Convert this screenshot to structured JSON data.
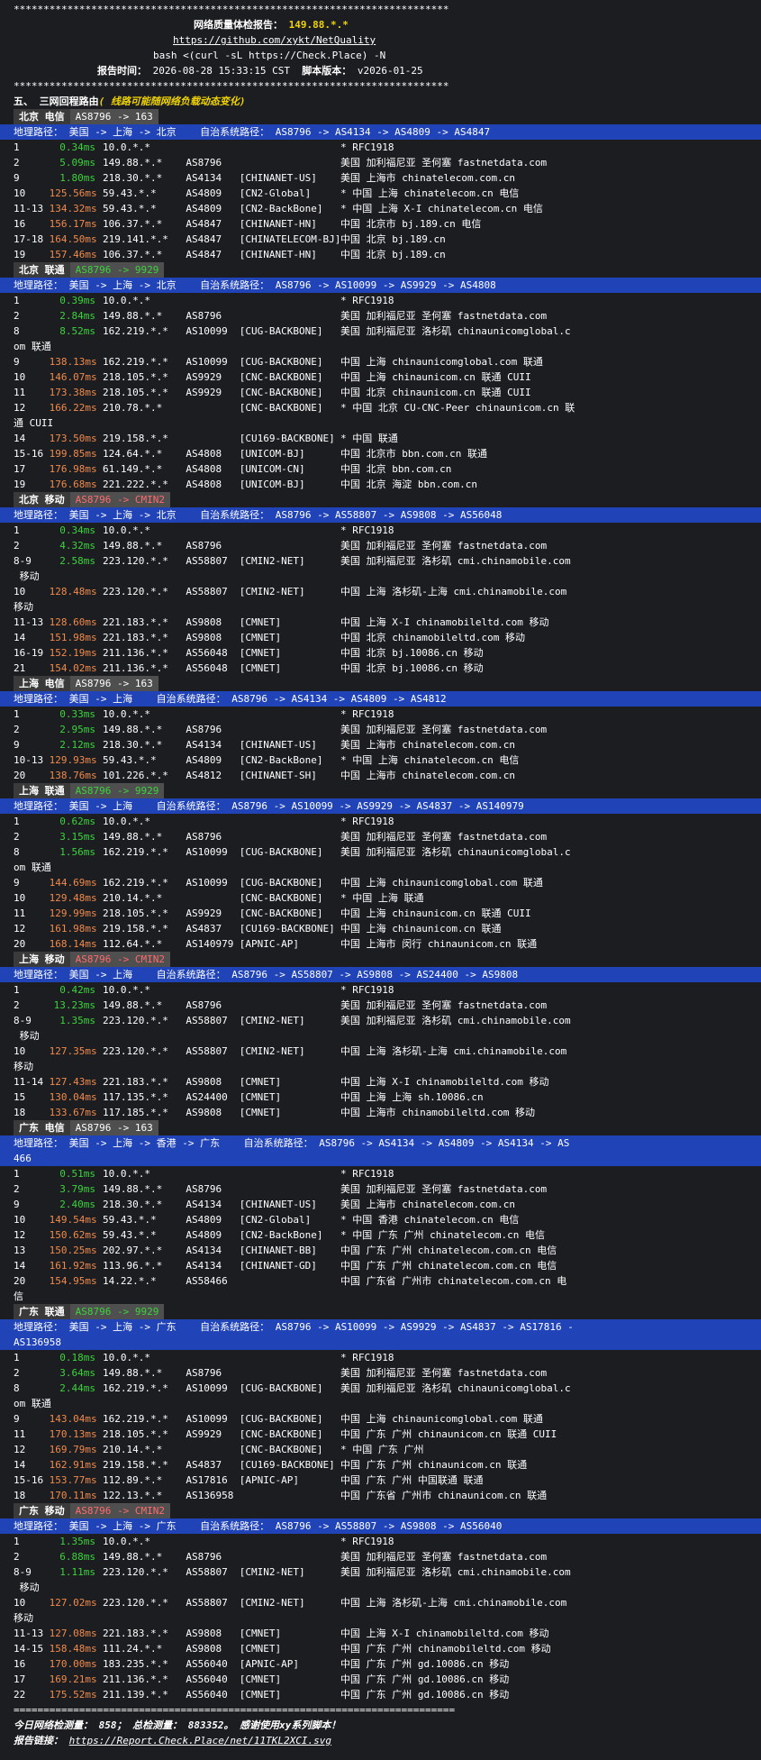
{
  "header": {
    "stars": "*************************************************************************",
    "title_label": "网络质量体检报告：",
    "title_ip": "149.88.*.*",
    "repo": "https://github.com/xykt/NetQuality",
    "cmd": "bash <(curl -sL https://Check.Place) -N",
    "time_label": "报告时间：",
    "time_value": "2026-08-28 15:33:15 CST",
    "ver_label": "脚本版本：",
    "ver_value": "v2026-01-25"
  },
  "section": {
    "num": "五、",
    "title": "三网回程路由",
    "note": "( 线路可能随网络负载动态变化)"
  },
  "blocks": [
    {
      "city": "北京",
      "isp": "电信",
      "as_tag": "AS8796 -> 163",
      "path": "地理路径： 美国 -> 上海 -> 北京    自治系统路径： AS8796 -> AS4134 -> AS4809 -> AS4847",
      "rows": [
        [
          "1",
          "0.34ms",
          "10.0.*.*",
          "",
          "",
          "* RFC1918"
        ],
        [
          "2",
          "5.09ms",
          "149.88.*.*",
          "AS8796",
          "",
          "美国 加利福尼亚 圣何塞 fastnetdata.com"
        ],
        [
          "9",
          "1.80ms",
          "218.30.*.*",
          "AS4134",
          "[CHINANET-US]",
          "美国 上海市 chinatelecom.com.cn"
        ],
        [
          "10",
          "125.56ms",
          "59.43.*.*",
          "AS4809",
          "[CN2-Global]",
          "* 中国 上海 chinatelecom.cn 电信"
        ],
        [
          "11-13",
          "134.32ms",
          "59.43.*.*",
          "AS4809",
          "[CN2-BackBone]",
          "* 中国 上海 X-I chinatelecom.cn 电信"
        ],
        [
          "16",
          "156.17ms",
          "106.37.*.*",
          "AS4847",
          "[CHINANET-HN]",
          "中国 北京市 bj.189.cn 电信"
        ],
        [
          "17-18",
          "164.50ms",
          "219.141.*.*",
          "AS4847",
          "[CHINATELECOM-BJ]",
          "中国 北京 bj.189.cn"
        ],
        [
          "19",
          "157.46ms",
          "106.37.*.*",
          "AS4847",
          "[CHINANET-HN]",
          "中国 北京 bj.189.cn"
        ]
      ]
    },
    {
      "city": "北京",
      "isp": "联通",
      "as_tag": "AS8796 -> 9929",
      "path": "地理路径： 美国 -> 上海 -> 北京    自治系统路径： AS8796 -> AS10099 -> AS9929 -> AS4808",
      "rows": [
        [
          "1",
          "0.39ms",
          "10.0.*.*",
          "",
          "",
          "* RFC1918"
        ],
        [
          "2",
          "2.84ms",
          "149.88.*.*",
          "AS8796",
          "",
          "美国 加利福尼亚 圣何塞 fastnetdata.com"
        ],
        [
          "8",
          "8.52ms",
          "162.219.*.*",
          "AS10099",
          "[CUG-BACKBONE]",
          "美国 加利福尼亚 洛杉矶 chinaunicomglobal.c",
          "om 联通"
        ],
        [
          "9",
          "138.13ms",
          "162.219.*.*",
          "AS10099",
          "[CUG-BACKBONE]",
          "中国 上海 chinaunicomglobal.com 联通"
        ],
        [
          "10",
          "146.07ms",
          "218.105.*.*",
          "AS9929",
          "[CNC-BACKBONE]",
          "中国 上海 chinaunicom.cn 联通 CUII"
        ],
        [
          "11",
          "173.38ms",
          "218.105.*.*",
          "AS9929",
          "[CNC-BACKBONE]",
          "中国 北京 chinaunicom.cn 联通 CUII"
        ],
        [
          "12",
          "166.22ms",
          "210.78.*.*",
          "",
          "[CNC-BACKBONE]",
          "* 中国 北京 CU-CNC-Peer chinaunicom.cn 联",
          "通 CUII"
        ],
        [
          "14",
          "173.50ms",
          "219.158.*.*",
          "",
          "[CU169-BACKBONE]",
          "* 中国 联通"
        ],
        [
          "15-16",
          "199.85ms",
          "124.64.*.*",
          "AS4808",
          "[UNICOM-BJ]",
          "中国 北京市 bbn.com.cn 联通"
        ],
        [
          "17",
          "176.98ms",
          "61.149.*.*",
          "AS4808",
          "[UNICOM-CN]",
          "中国 北京 bbn.com.cn"
        ],
        [
          "19",
          "176.68ms",
          "221.222.*.*",
          "AS4808",
          "[UNICOM-BJ]",
          "中国 北京 海淀 bbn.com.cn"
        ]
      ]
    },
    {
      "city": "北京",
      "isp": "移动",
      "as_tag": "AS8796 -> CMIN2",
      "path": "地理路径： 美国 -> 上海 -> 北京    自治系统路径： AS8796 -> AS58807 -> AS9808 -> AS56048",
      "rows": [
        [
          "1",
          "0.34ms",
          "10.0.*.*",
          "",
          "",
          "* RFC1918"
        ],
        [
          "2",
          "4.32ms",
          "149.88.*.*",
          "AS8796",
          "",
          "美国 加利福尼亚 圣何塞 fastnetdata.com"
        ],
        [
          "8-9",
          "2.58ms",
          "223.120.*.*",
          "AS58807",
          "[CMIN2-NET]",
          "美国 加利福尼亚 洛杉矶 cmi.chinamobile.com",
          " 移动"
        ],
        [
          "10",
          "128.48ms",
          "223.120.*.*",
          "AS58807",
          "[CMIN2-NET]",
          "中国 上海 洛杉矶-上海 cmi.chinamobile.com",
          "移动"
        ],
        [
          "11-13",
          "128.60ms",
          "221.183.*.*",
          "AS9808",
          "[CMNET]",
          "中国 上海 X-I chinamobileltd.com 移动"
        ],
        [
          "14",
          "151.98ms",
          "221.183.*.*",
          "AS9808",
          "[CMNET]",
          "中国 北京 chinamobileltd.com 移动"
        ],
        [
          "16-19",
          "152.19ms",
          "211.136.*.*",
          "AS56048",
          "[CMNET]",
          "中国 北京 bj.10086.cn 移动"
        ],
        [
          "21",
          "154.02ms",
          "211.136.*.*",
          "AS56048",
          "[CMNET]",
          "中国 北京 bj.10086.cn 移动"
        ]
      ]
    },
    {
      "city": "上海",
      "isp": "电信",
      "as_tag": "AS8796 -> 163",
      "path": "地理路径： 美国 -> 上海    自治系统路径： AS8796 -> AS4134 -> AS4809 -> AS4812",
      "rows": [
        [
          "1",
          "0.33ms",
          "10.0.*.*",
          "",
          "",
          "* RFC1918"
        ],
        [
          "2",
          "2.95ms",
          "149.88.*.*",
          "AS8796",
          "",
          "美国 加利福尼亚 圣何塞 fastnetdata.com"
        ],
        [
          "9",
          "2.12ms",
          "218.30.*.*",
          "AS4134",
          "[CHINANET-US]",
          "美国 上海市 chinatelecom.com.cn"
        ],
        [
          "10-13",
          "129.93ms",
          "59.43.*.*",
          "AS4809",
          "[CN2-BackBone]",
          "* 中国 上海 chinatelecom.cn 电信"
        ],
        [
          "20",
          "138.76ms",
          "101.226.*.*",
          "AS4812",
          "[CHINANET-SH]",
          "中国 上海市 chinatelecom.com.cn"
        ]
      ]
    },
    {
      "city": "上海",
      "isp": "联通",
      "as_tag": "AS8796 -> 9929",
      "path": "地理路径： 美国 -> 上海    自治系统路径： AS8796 -> AS10099 -> AS9929 -> AS4837 -> AS140979",
      "rows": [
        [
          "1",
          "0.62ms",
          "10.0.*.*",
          "",
          "",
          "* RFC1918"
        ],
        [
          "2",
          "3.15ms",
          "149.88.*.*",
          "AS8796",
          "",
          "美国 加利福尼亚 圣何塞 fastnetdata.com"
        ],
        [
          "8",
          "1.56ms",
          "162.219.*.*",
          "AS10099",
          "[CUG-BACKBONE]",
          "美国 加利福尼亚 洛杉矶 chinaunicomglobal.c",
          "om 联通"
        ],
        [
          "9",
          "144.69ms",
          "162.219.*.*",
          "AS10099",
          "[CUG-BACKBONE]",
          "中国 上海 chinaunicomglobal.com 联通"
        ],
        [
          "10",
          "129.48ms",
          "210.14.*.*",
          "",
          "[CNC-BACKBONE]",
          "* 中国 上海 联通"
        ],
        [
          "11",
          "129.99ms",
          "218.105.*.*",
          "AS9929",
          "[CNC-BACKBONE]",
          "中国 上海 chinaunicom.cn 联通 CUII"
        ],
        [
          "12",
          "161.98ms",
          "219.158.*.*",
          "AS4837",
          "[CU169-BACKBONE]",
          "中国 上海 chinaunicom.cn 联通"
        ],
        [
          "20",
          "168.14ms",
          "112.64.*.*",
          "AS140979",
          "[APNIC-AP]",
          "中国 上海市 闵行 chinaunicom.cn 联通"
        ]
      ]
    },
    {
      "city": "上海",
      "isp": "移动",
      "as_tag": "AS8796 -> CMIN2",
      "path": "地理路径： 美国 -> 上海    自治系统路径： AS8796 -> AS58807 -> AS9808 -> AS24400 -> AS9808",
      "rows": [
        [
          "1",
          "0.42ms",
          "10.0.*.*",
          "",
          "",
          "* RFC1918"
        ],
        [
          "2",
          "13.23ms",
          "149.88.*.*",
          "AS8796",
          "",
          "美国 加利福尼亚 圣何塞 fastnetdata.com"
        ],
        [
          "8-9",
          "1.35ms",
          "223.120.*.*",
          "AS58807",
          "[CMIN2-NET]",
          "美国 加利福尼亚 洛杉矶 cmi.chinamobile.com",
          " 移动"
        ],
        [
          "10",
          "127.35ms",
          "223.120.*.*",
          "AS58807",
          "[CMIN2-NET]",
          "中国 上海 洛杉矶-上海 cmi.chinamobile.com",
          "移动"
        ],
        [
          "11-14",
          "127.43ms",
          "221.183.*.*",
          "AS9808",
          "[CMNET]",
          "中国 上海 X-I chinamobileltd.com 移动"
        ],
        [
          "15",
          "130.04ms",
          "117.135.*.*",
          "AS24400",
          "[CMNET]",
          "中国 上海 上海 sh.10086.cn"
        ],
        [
          "18",
          "133.67ms",
          "117.185.*.*",
          "AS9808",
          "[CMNET]",
          "中国 上海市 chinamobileltd.com 移动"
        ]
      ]
    },
    {
      "city": "广东",
      "isp": "电信",
      "as_tag": "AS8796 -> 163",
      "path": "地理路径： 美国 -> 上海 -> 香港 -> 广东    自治系统路径： AS8796 -> AS4134 -> AS4809 -> AS4134 -> AS",
      "path2": "466",
      "rows": [
        [
          "1",
          "0.51ms",
          "10.0.*.*",
          "",
          "",
          "* RFC1918"
        ],
        [
          "2",
          "3.79ms",
          "149.88.*.*",
          "AS8796",
          "",
          "美国 加利福尼亚 圣何塞 fastnetdata.com"
        ],
        [
          "9",
          "2.40ms",
          "218.30.*.*",
          "AS4134",
          "[CHINANET-US]",
          "美国 上海市 chinatelecom.com.cn"
        ],
        [
          "10",
          "149.54ms",
          "59.43.*.*",
          "AS4809",
          "[CN2-Global]",
          "* 中国 香港 chinatelecom.cn 电信"
        ],
        [
          "12",
          "150.62ms",
          "59.43.*.*",
          "AS4809",
          "[CN2-BackBone]",
          "* 中国 广东 广州 chinatelecom.cn 电信"
        ],
        [
          "13",
          "150.25ms",
          "202.97.*.*",
          "AS4134",
          "[CHINANET-BB]",
          "中国 广东 广州 chinatelecom.com.cn 电信"
        ],
        [
          "14",
          "161.92ms",
          "113.96.*.*",
          "AS4134",
          "[CHINANET-GD]",
          "中国 广东 广州 chinatelecom.com.cn 电信"
        ],
        [
          "20",
          "154.95ms",
          "14.22.*.*",
          "AS58466",
          "",
          "中国 广东省 广州市 chinatelecom.com.cn 电",
          "信"
        ]
      ]
    },
    {
      "city": "广东",
      "isp": "联通",
      "as_tag": "AS8796 -> 9929",
      "path": "地理路径： 美国 -> 上海 -> 广东    自治系统路径： AS8796 -> AS10099 -> AS9929 -> AS4837 -> AS17816 -",
      "path2": "AS136958",
      "rows": [
        [
          "1",
          "0.18ms",
          "10.0.*.*",
          "",
          "",
          "* RFC1918"
        ],
        [
          "2",
          "3.64ms",
          "149.88.*.*",
          "AS8796",
          "",
          "美国 加利福尼亚 圣何塞 fastnetdata.com"
        ],
        [
          "8",
          "2.44ms",
          "162.219.*.*",
          "AS10099",
          "[CUG-BACKBONE]",
          "美国 加利福尼亚 洛杉矶 chinaunicomglobal.c",
          "om 联通"
        ],
        [
          "9",
          "143.04ms",
          "162.219.*.*",
          "AS10099",
          "[CUG-BACKBONE]",
          "中国 上海 chinaunicomglobal.com 联通"
        ],
        [
          "11",
          "170.13ms",
          "218.105.*.*",
          "AS9929",
          "[CNC-BACKBONE]",
          "中国 广东 广州 chinaunicom.cn 联通 CUII"
        ],
        [
          "12",
          "169.79ms",
          "210.14.*.*",
          "",
          "[CNC-BACKBONE]",
          "* 中国 广东 广州"
        ],
        [
          "14",
          "162.91ms",
          "219.158.*.*",
          "AS4837",
          "[CU169-BACKBONE]",
          "中国 广东 广州 chinaunicom.cn 联通"
        ],
        [
          "15-16",
          "153.77ms",
          "112.89.*.*",
          "AS17816",
          "[APNIC-AP]",
          "中国 广东 广州 中国联通 联通"
        ],
        [
          "18",
          "170.11ms",
          "122.13.*.*",
          "AS136958",
          "",
          "中国 广东省 广州市 chinaunicom.cn 联通"
        ]
      ]
    },
    {
      "city": "广东",
      "isp": "移动",
      "as_tag": "AS8796 -> CMIN2",
      "path": "地理路径： 美国 -> 上海 -> 广东    自治系统路径： AS8796 -> AS58807 -> AS9808 -> AS56040",
      "rows": [
        [
          "1",
          "1.35ms",
          "10.0.*.*",
          "",
          "",
          "* RFC1918"
        ],
        [
          "2",
          "6.88ms",
          "149.88.*.*",
          "AS8796",
          "",
          "美国 加利福尼亚 圣何塞 fastnetdata.com"
        ],
        [
          "8-9",
          "1.11ms",
          "223.120.*.*",
          "AS58807",
          "[CMIN2-NET]",
          "美国 加利福尼亚 洛杉矶 cmi.chinamobile.com",
          " 移动"
        ],
        [
          "10",
          "127.02ms",
          "223.120.*.*",
          "AS58807",
          "[CMIN2-NET]",
          "中国 上海 洛杉矶-上海 cmi.chinamobile.com",
          "移动"
        ],
        [
          "11-13",
          "127.08ms",
          "221.183.*.*",
          "AS9808",
          "[CMNET]",
          "中国 上海 X-I chinamobileltd.com 移动"
        ],
        [
          "14-15",
          "158.48ms",
          "111.24.*.*",
          "AS9808",
          "[CMNET]",
          "中国 广东 广州 chinamobileltd.com 移动"
        ],
        [
          "16",
          "170.00ms",
          "183.235.*.*",
          "AS56040",
          "[APNIC-AP]",
          "中国 广东 广州 gd.10086.cn 移动"
        ],
        [
          "17",
          "169.21ms",
          "211.136.*.*",
          "AS56040",
          "[CMNET]",
          "中国 广东 广州 gd.10086.cn 移动"
        ],
        [
          "22",
          "175.52ms",
          "211.139.*.*",
          "AS56040",
          "[CMNET]",
          "中国 广东 广州 gd.10086.cn 移动"
        ]
      ]
    }
  ],
  "footer": {
    "sep": "==========================================================================",
    "stats": "今日网络检测量： 858； 总检测量： 883352。 感谢使用xy系列脚本！",
    "link_label": "报告链接：",
    "link": "https://Report.Check.Place/net/11TKL2XCI.svg"
  },
  "colors": {
    "bg": "#1c1d21",
    "path_bg": "#2043b8",
    "city_bg": "#3a3a3a",
    "as_bg": "#4f4f4f",
    "latency_low": "#3cd33c",
    "latency_high": "#f08a4b",
    "heading": "#f0d400"
  }
}
